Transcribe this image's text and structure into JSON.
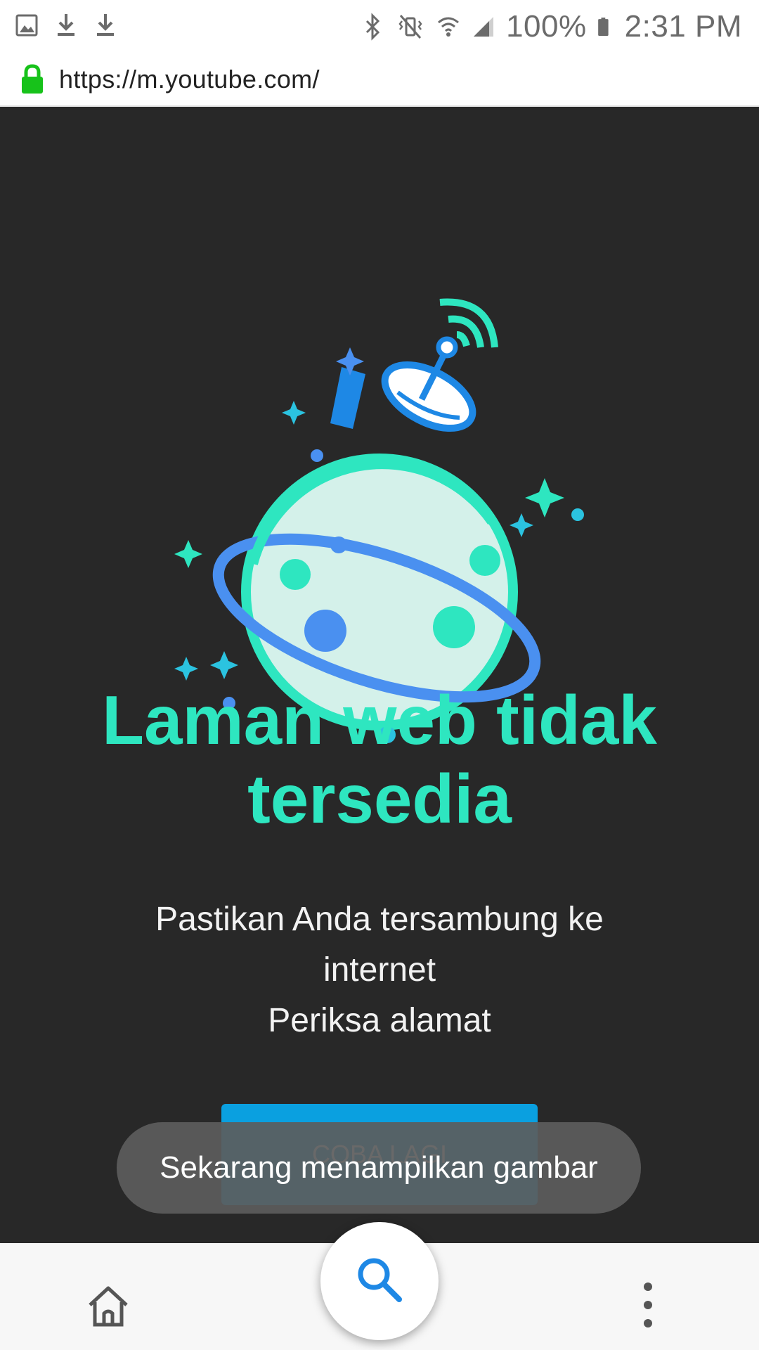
{
  "status_bar": {
    "battery": "100%",
    "time": "2:31 PM",
    "left_icons": [
      "image-icon",
      "download-icon",
      "download-icon"
    ],
    "right_icons": [
      "bluetooth-icon",
      "vibrate-icon",
      "wifi-icon",
      "signal-icon",
      "battery-icon"
    ]
  },
  "url_bar": {
    "url": "https://m.youtube.com/",
    "lock_color": "#17c21a"
  },
  "error_page": {
    "title": "Laman web tidak tersedia",
    "line1": "Pastikan Anda tersambung ke internet",
    "line2": "Periksa alamat",
    "retry_label": "COBA LAGI",
    "title_color": "#2ee6c0",
    "background": "#282828"
  },
  "toast": {
    "message": "Sekarang menampilkan gambar"
  },
  "bottom_nav": {
    "home_icon": "home-icon",
    "search_icon": "search-icon",
    "menu_icon": "more-vert-icon",
    "accent": "#1e88e5"
  }
}
